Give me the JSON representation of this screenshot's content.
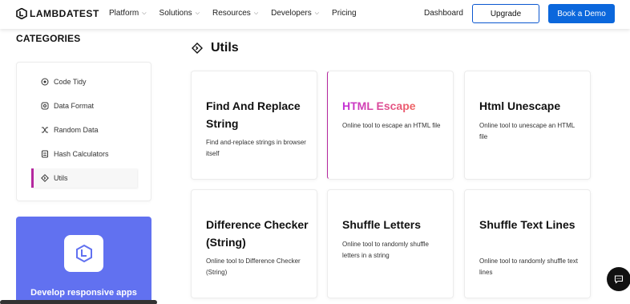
{
  "header": {
    "logo": "LAMBDATEST",
    "nav": [
      {
        "label": "Platform",
        "has_menu": true
      },
      {
        "label": "Solutions",
        "has_menu": true
      },
      {
        "label": "Resources",
        "has_menu": true
      },
      {
        "label": "Developers",
        "has_menu": true
      },
      {
        "label": "Pricing",
        "has_menu": false
      }
    ],
    "dashboard": "Dashboard",
    "upgrade": "Upgrade",
    "book_demo": "Book a Demo",
    "accent": "#0b67dc"
  },
  "sidebar": {
    "title": "CATEGORIES",
    "items": [
      {
        "label": "Code Tidy",
        "icon": "code-tidy-icon"
      },
      {
        "label": "Data Format",
        "icon": "data-format-icon"
      },
      {
        "label": "Random Data",
        "icon": "shuffle-icon"
      },
      {
        "label": "Hash Calculators",
        "icon": "hash-icon"
      },
      {
        "label": "Utils",
        "icon": "utils-icon",
        "active": true
      }
    ],
    "active_color": "#b4279e"
  },
  "promo": {
    "text": "Develop responsive apps",
    "background": "#6171f0"
  },
  "main": {
    "title": "Utils",
    "cards": [
      {
        "title": "Find And Replace String",
        "desc": "Find and-replace strings in browser itself"
      },
      {
        "title": "HTML Escape",
        "desc": "Online tool to escape an HTML file",
        "highlighted": true
      },
      {
        "title": "Html Unescape",
        "desc": "Online tool to unescape an HTML file"
      },
      {
        "title": "Difference Checker (String)",
        "desc": "Online tool to Difference Checker (String)"
      },
      {
        "title": "Shuffle Letters",
        "desc": "Online tool to randomly shuffle letters in a string"
      },
      {
        "title": "Shuffle Text Lines",
        "desc": "Online tool to randomly shuffle text lines"
      }
    ]
  }
}
